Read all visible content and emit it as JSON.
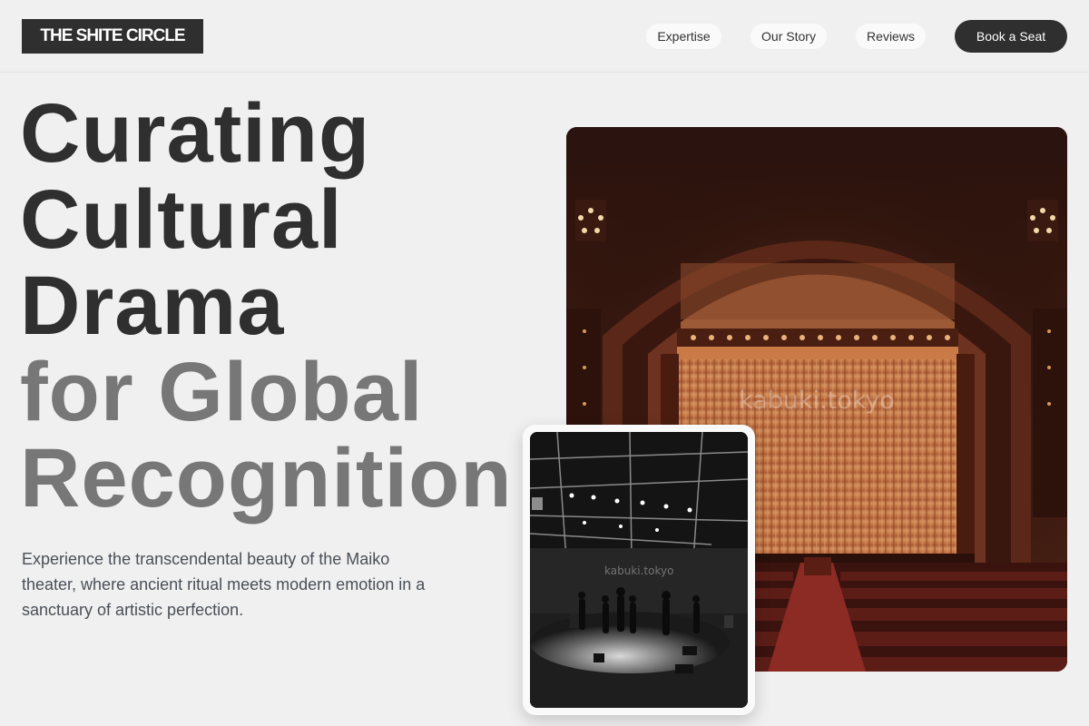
{
  "header": {
    "logo": "THE SHITE CIRCLE",
    "nav": [
      {
        "label": "Expertise"
      },
      {
        "label": "Our Story"
      },
      {
        "label": "Reviews"
      }
    ],
    "cta_label": "Book a Seat"
  },
  "hero": {
    "title_dark": [
      "Curating",
      "Cultural",
      "Drama"
    ],
    "title_light": [
      "for Global",
      "Recognition"
    ],
    "lead": "Experience the transcendental beauty of the Maiko theater, where ancient ritual meets modern emotion in a sanctuary of artistic perfection."
  },
  "images": {
    "main_watermark": "kabuki.tokyo",
    "card_watermark": "kabuki.tokyo"
  },
  "colors": {
    "background": "#f0f0f0",
    "text_dark": "#2f2f2f",
    "text_light": "#777777",
    "button": "#2f2f2f",
    "curtain": "#e08a52"
  }
}
